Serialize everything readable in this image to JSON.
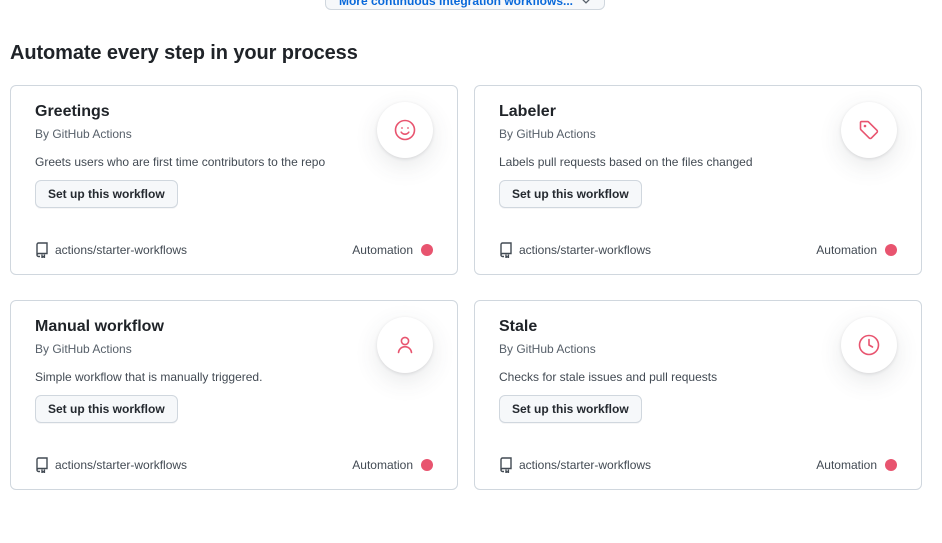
{
  "top_button": {
    "label": "More continuous integration workflows..."
  },
  "section": {
    "title": "Automate every step in your process"
  },
  "colors": {
    "accent_icon": "#e8546f",
    "category_dot": "#e8546f"
  },
  "cards": [
    {
      "title": "Greetings",
      "author": "By GitHub Actions",
      "description": "Greets users who are first time contributors to the repo",
      "button": "Set up this workflow",
      "repo": "actions/starter-workflows",
      "category": "Automation",
      "icon": "smiley-icon"
    },
    {
      "title": "Labeler",
      "author": "By GitHub Actions",
      "description": "Labels pull requests based on the files changed",
      "button": "Set up this workflow",
      "repo": "actions/starter-workflows",
      "category": "Automation",
      "icon": "tag-icon"
    },
    {
      "title": "Manual workflow",
      "author": "By GitHub Actions",
      "description": "Simple workflow that is manually triggered.",
      "button": "Set up this workflow",
      "repo": "actions/starter-workflows",
      "category": "Automation",
      "icon": "person-icon"
    },
    {
      "title": "Stale",
      "author": "By GitHub Actions",
      "description": "Checks for stale issues and pull requests",
      "button": "Set up this workflow",
      "repo": "actions/starter-workflows",
      "category": "Automation",
      "icon": "clock-icon"
    }
  ]
}
